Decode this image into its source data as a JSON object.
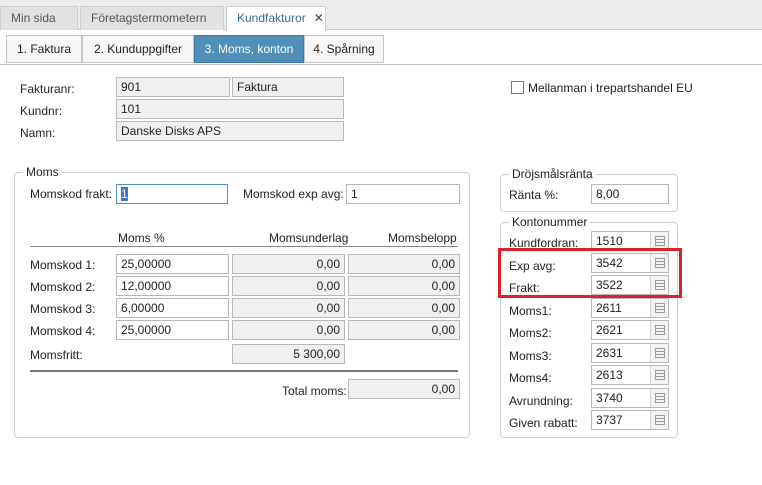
{
  "tabs": [
    {
      "label": "Min sida"
    },
    {
      "label": "Företagstermometern"
    },
    {
      "label": "Kundfakturor"
    }
  ],
  "tab_close": "✕",
  "subtabs": [
    {
      "label": "1. Faktura"
    },
    {
      "label": "2. Kunduppgifter"
    },
    {
      "label": "3. Moms, konton"
    },
    {
      "label": "4. Spårning"
    }
  ],
  "header": {
    "fakturanr_label": "Fakturanr:",
    "fakturanr_value": "901",
    "fakturatyp_value": "Faktura",
    "kundnr_label": "Kundnr:",
    "kundnr_value": "101",
    "namn_label": "Namn:",
    "namn_value": "Danske Disks APS",
    "mellanman_label": "Mellanman i trepartshandel EU"
  },
  "moms": {
    "title": "Moms",
    "momskod_frakt_label": "Momskod frakt:",
    "momskod_frakt_value": "1",
    "momskod_exp_label": "Momskod exp avg:",
    "momskod_exp_value": "1",
    "col_moms": "Moms %",
    "col_underlag": "Momsunderlag",
    "col_belopp": "Momsbelopp",
    "rows": [
      {
        "label": "Momskod 1:",
        "pct": "25,00000",
        "underlag": "0,00",
        "belopp": "0,00"
      },
      {
        "label": "Momskod 2:",
        "pct": "12,00000",
        "underlag": "0,00",
        "belopp": "0,00"
      },
      {
        "label": "Momskod 3:",
        "pct": "6,00000",
        "underlag": "0,00",
        "belopp": "0,00"
      },
      {
        "label": "Momskod 4:",
        "pct": "25,00000",
        "underlag": "0,00",
        "belopp": "0,00"
      }
    ],
    "momsfritt_label": "Momsfritt:",
    "momsfritt_value": "5 300,00",
    "total_label": "Total moms:",
    "total_value": "0,00"
  },
  "drojsmal": {
    "title": "Dröjsmålsränta",
    "ranta_label": "Ränta %:",
    "ranta_value": "8,00"
  },
  "konton": {
    "title": "Kontonummer",
    "rows": [
      {
        "label": "Kundfordran:",
        "value": "1510"
      },
      {
        "label": "Exp avg:",
        "value": "3542"
      },
      {
        "label": "Frakt:",
        "value": "3522"
      },
      {
        "label": "Moms1:",
        "value": "2611"
      },
      {
        "label": "Moms2:",
        "value": "2621"
      },
      {
        "label": "Moms3:",
        "value": "2631"
      },
      {
        "label": "Moms4:",
        "value": "2613"
      },
      {
        "label": "Avrundning:",
        "value": "3740"
      },
      {
        "label": "Given rabatt:",
        "value": "3737"
      }
    ]
  },
  "colors": {
    "active_subtab": "#4f8fb8",
    "highlight": "#d8232a",
    "active_tab_text": "#2e6f9a"
  }
}
